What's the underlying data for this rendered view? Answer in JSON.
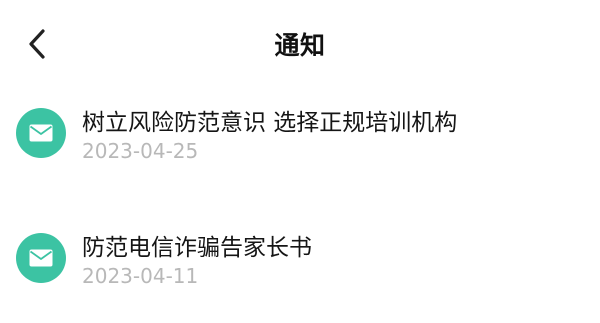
{
  "header": {
    "title": "通知",
    "back_icon": "chevron-left-icon"
  },
  "notices": [
    {
      "title": "树立风险防范意识 选择正规培训机构",
      "date": "2023-04-25",
      "icon": "mail-icon"
    },
    {
      "title": "防范电信诈骗告家长书",
      "date": "2023-04-11",
      "icon": "mail-icon"
    }
  ],
  "colors": {
    "icon_background": "#3cc3a3",
    "date_text": "#b8b8b8",
    "title_text": "#151515"
  }
}
